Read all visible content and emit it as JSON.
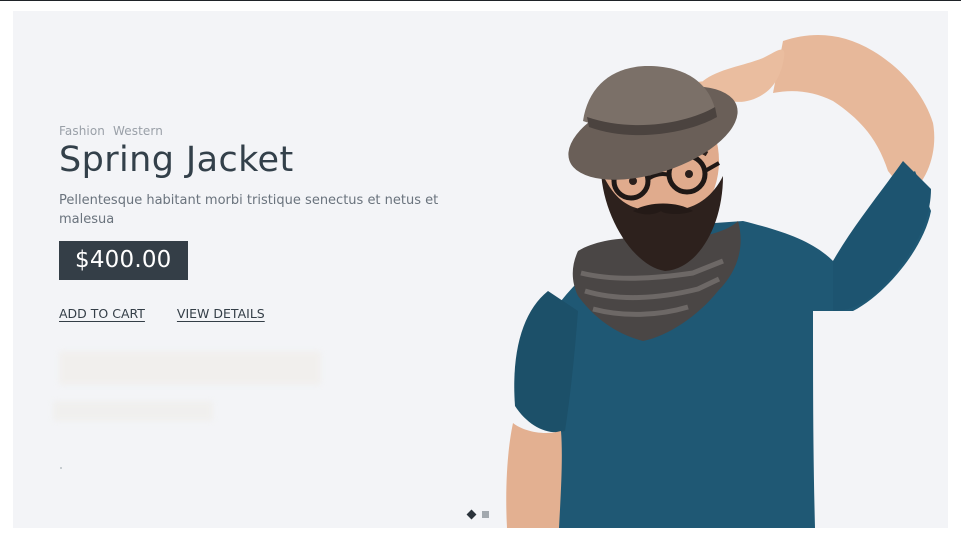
{
  "hero": {
    "tags": [
      "Fashion",
      "Western"
    ],
    "title": "Spring Jacket",
    "description": "Pellentesque habitant morbi tristique senectus et netus et malesua",
    "price": "$400.00",
    "actions": {
      "add_to_cart": "ADD TO CART",
      "view_details": "VIEW DETAILS"
    },
    "image_icon": "man-in-hat-photo"
  },
  "pager": {
    "active_index": 0,
    "count": 2
  },
  "colors": {
    "background": "#f3f4f7",
    "heading": "#33404a",
    "price_bg": "#343e47",
    "sweater": "#1f5874"
  }
}
